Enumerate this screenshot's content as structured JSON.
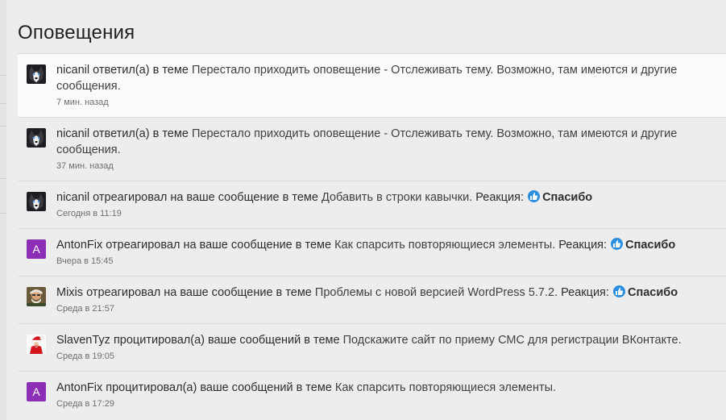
{
  "page": {
    "title": "Оповещения"
  },
  "notifications": [
    {
      "user": "nicanil",
      "action": "ответил(а) в теме",
      "thread": "Перестало приходить оповещение - Отслеживать тему. Возможно, там имеются и другие сообщения.",
      "reaction": "",
      "time": "7 мин. назад",
      "avatar": "husky"
    },
    {
      "user": "nicanil",
      "action": "ответил(а) в теме",
      "thread": "Перестало приходить оповещение - Отслеживать тему. Возможно, там имеются и другие сообщения.",
      "reaction": "",
      "time": "37 мин. назад",
      "avatar": "husky"
    },
    {
      "user": "nicanil",
      "action": "отреагировал на ваше сообщение в теме",
      "thread": "Добавить в строки кавычки.",
      "reaction_label": "Реакция:",
      "reaction": "Спасибо",
      "time": "Сегодня в 11:19",
      "avatar": "husky"
    },
    {
      "user": "AntonFix",
      "action": "отреагировал на ваше сообщение в теме",
      "thread": "Как спарсить повторяющиеся элементы.",
      "reaction_label": "Реакция:",
      "reaction": "Спасибо",
      "time": "Вчера в 15:45",
      "avatar": "A"
    },
    {
      "user": "Mixis",
      "action": "отреагировал на ваше сообщение в теме",
      "thread": "Проблемы с новой версией WordPress 5.7.2.",
      "reaction_label": "Реакция:",
      "reaction": "Спасибо",
      "time": "Среда в 21:57",
      "avatar": "photo"
    },
    {
      "user": "SlavenTyz",
      "action": "процитировал(а) ваше сообщений в теме",
      "thread": "Подскажите сайт по приему СМС для регистрации ВКонтакте.",
      "reaction": "",
      "time": "Среда в 19:05",
      "avatar": "santa"
    },
    {
      "user": "AntonFix",
      "action": "процитировал(а) ваше сообщений в теме",
      "thread": "Как спарсить повторяющиеся элементы.",
      "reaction": "",
      "time": "Среда в 17:29",
      "avatar": "A"
    }
  ],
  "colors": {
    "reaction_blue": "#2a8fe0",
    "letter_avatar": "#8a2fb6",
    "background": "#ededed",
    "unread_background": "#fbfbfb"
  }
}
